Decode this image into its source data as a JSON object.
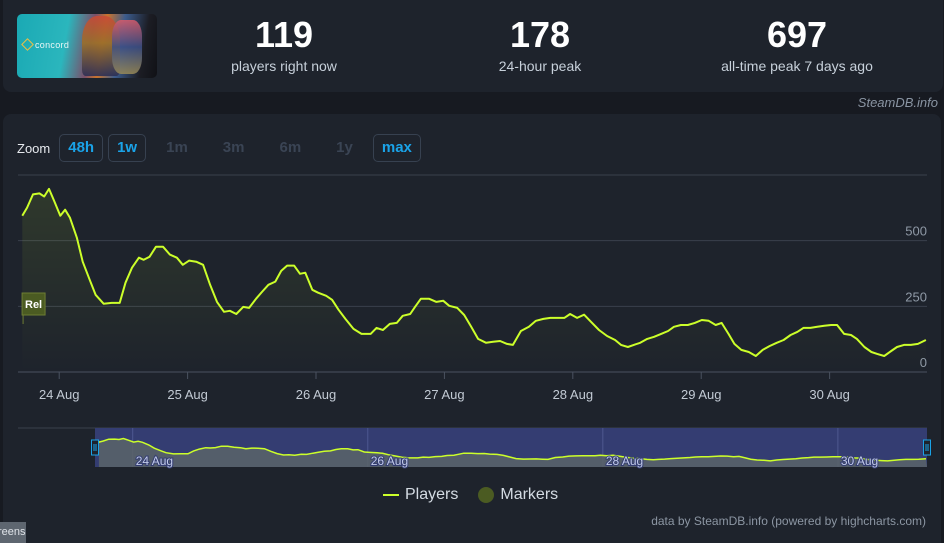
{
  "header": {
    "game_logo_text": "concord",
    "stats": [
      {
        "value": "119",
        "label": "players right now"
      },
      {
        "value": "178",
        "label": "24-hour peak"
      },
      {
        "value": "697",
        "label": "all-time peak 7 days ago"
      }
    ],
    "watermark": "SteamDB.info"
  },
  "zoom": {
    "label": "Zoom",
    "buttons": [
      {
        "label": "48h",
        "enabled": true
      },
      {
        "label": "1w",
        "enabled": true
      },
      {
        "label": "1m",
        "enabled": false
      },
      {
        "label": "3m",
        "enabled": false
      },
      {
        "label": "6m",
        "enabled": false
      },
      {
        "label": "1y",
        "enabled": false
      },
      {
        "label": "max",
        "enabled": true
      }
    ]
  },
  "chart_data": {
    "type": "line",
    "title": "",
    "xlabel": "",
    "ylabel": "",
    "x_unit": "hours since 23 Aug 00:00",
    "xlim": [
      16.3,
      186.2
    ],
    "ylim": [
      0,
      750
    ],
    "y_ticks": [
      0,
      250,
      500
    ],
    "y_tick_labels": [
      "0",
      "250",
      "500"
    ],
    "x_ticks": [
      24,
      48,
      72,
      96,
      120,
      144,
      168
    ],
    "x_tick_labels": [
      "24 Aug",
      "25 Aug",
      "26 Aug",
      "27 Aug",
      "28 Aug",
      "29 Aug",
      "30 Aug"
    ],
    "grid": true,
    "series": [
      {
        "name": "Players",
        "color": "#ccff2a",
        "x": [
          17.1,
          18.0,
          19.1,
          20.3,
          21.2,
          22.1,
          23.1,
          24.2,
          25.1,
          26.0,
          27.3,
          28.4,
          29.7,
          30.8,
          32.3,
          33.8,
          35.3,
          36.4,
          37.6,
          38.9,
          39.8,
          40.9,
          42.1,
          43.4,
          44.7,
          46.0,
          47.1,
          48.3,
          49.6,
          50.9,
          52.2,
          53.5,
          54.8,
          55.9,
          57.1,
          58.4,
          59.5,
          60.8,
          61.9,
          63.1,
          64.4,
          65.5,
          66.6,
          67.9,
          69.0,
          70.0,
          71.3,
          72.4,
          73.9,
          75.0,
          76.2,
          77.5,
          79.0,
          80.5,
          82.2,
          83.3,
          84.5,
          85.8,
          87.1,
          88.2,
          89.6,
          90.5,
          91.6,
          93.1,
          94.5,
          95.8,
          96.9,
          98.4,
          99.7,
          101.0,
          102.3,
          103.8,
          105.1,
          106.4,
          107.7,
          108.8,
          110.3,
          111.8,
          113.1,
          114.5,
          115.8,
          117.1,
          118.4,
          119.5,
          120.8,
          122.1,
          123.4,
          124.9,
          126.4,
          127.9,
          129.0,
          130.3,
          131.4,
          132.6,
          133.9,
          135.2,
          136.5,
          137.8,
          138.9,
          140.2,
          141.5,
          142.8,
          144.1,
          145.4,
          146.7,
          147.8,
          149.1,
          150.2,
          151.5,
          152.9,
          154.2,
          155.5,
          156.8,
          158.1,
          159.4,
          160.7,
          162.0,
          163.1,
          164.4,
          165.7,
          167.0,
          168.3,
          169.4,
          170.7,
          172.0,
          173.1,
          174.5,
          175.8,
          176.9,
          178.2,
          179.5,
          180.6,
          181.9,
          183.2,
          184.5,
          186.0
        ],
        "values": [
          595,
          626,
          676,
          680,
          668,
          697,
          649,
          595,
          618,
          588,
          511,
          420,
          351,
          294,
          260,
          263,
          263,
          340,
          397,
          435,
          427,
          439,
          477,
          477,
          447,
          435,
          408,
          424,
          420,
          408,
          332,
          267,
          229,
          233,
          221,
          248,
          244,
          279,
          305,
          332,
          344,
          385,
          405,
          405,
          374,
          378,
          313,
          302,
          290,
          275,
          237,
          202,
          164,
          145,
          145,
          168,
          160,
          183,
          187,
          214,
          221,
          248,
          279,
          279,
          267,
          271,
          252,
          244,
          217,
          172,
          126,
          111,
          115,
          118,
          107,
          103,
          156,
          172,
          195,
          202,
          206,
          206,
          206,
          221,
          206,
          218,
          191,
          160,
          137,
          122,
          103,
          95,
          103,
          111,
          126,
          134,
          145,
          156,
          172,
          179,
          179,
          187,
          198,
          195,
          179,
          187,
          145,
          107,
          84,
          76,
          61,
          84,
          99,
          111,
          122,
          141,
          153,
          168,
          168,
          172,
          176,
          179,
          179,
          145,
          141,
          126,
          95,
          76,
          69,
          61,
          80,
          95,
          103,
          103,
          107,
          122
        ]
      },
      {
        "name": "Markers",
        "color": "#4b5b22",
        "flags": [
          {
            "x": 16.5,
            "label": "Rel"
          }
        ]
      }
    ],
    "navigator": {
      "x_tick_labels": [
        "24 Aug",
        "26 Aug",
        "28 Aug",
        "30 Aug"
      ],
      "x_ticks": [
        24,
        72,
        120,
        168
      ],
      "selected_range": "max"
    },
    "legend": {
      "placement": "bottom-center",
      "entries": [
        "Players",
        "Markers"
      ]
    }
  },
  "credit": "data by SteamDB.info (powered by highcharts.com)",
  "corner_label": "reens"
}
